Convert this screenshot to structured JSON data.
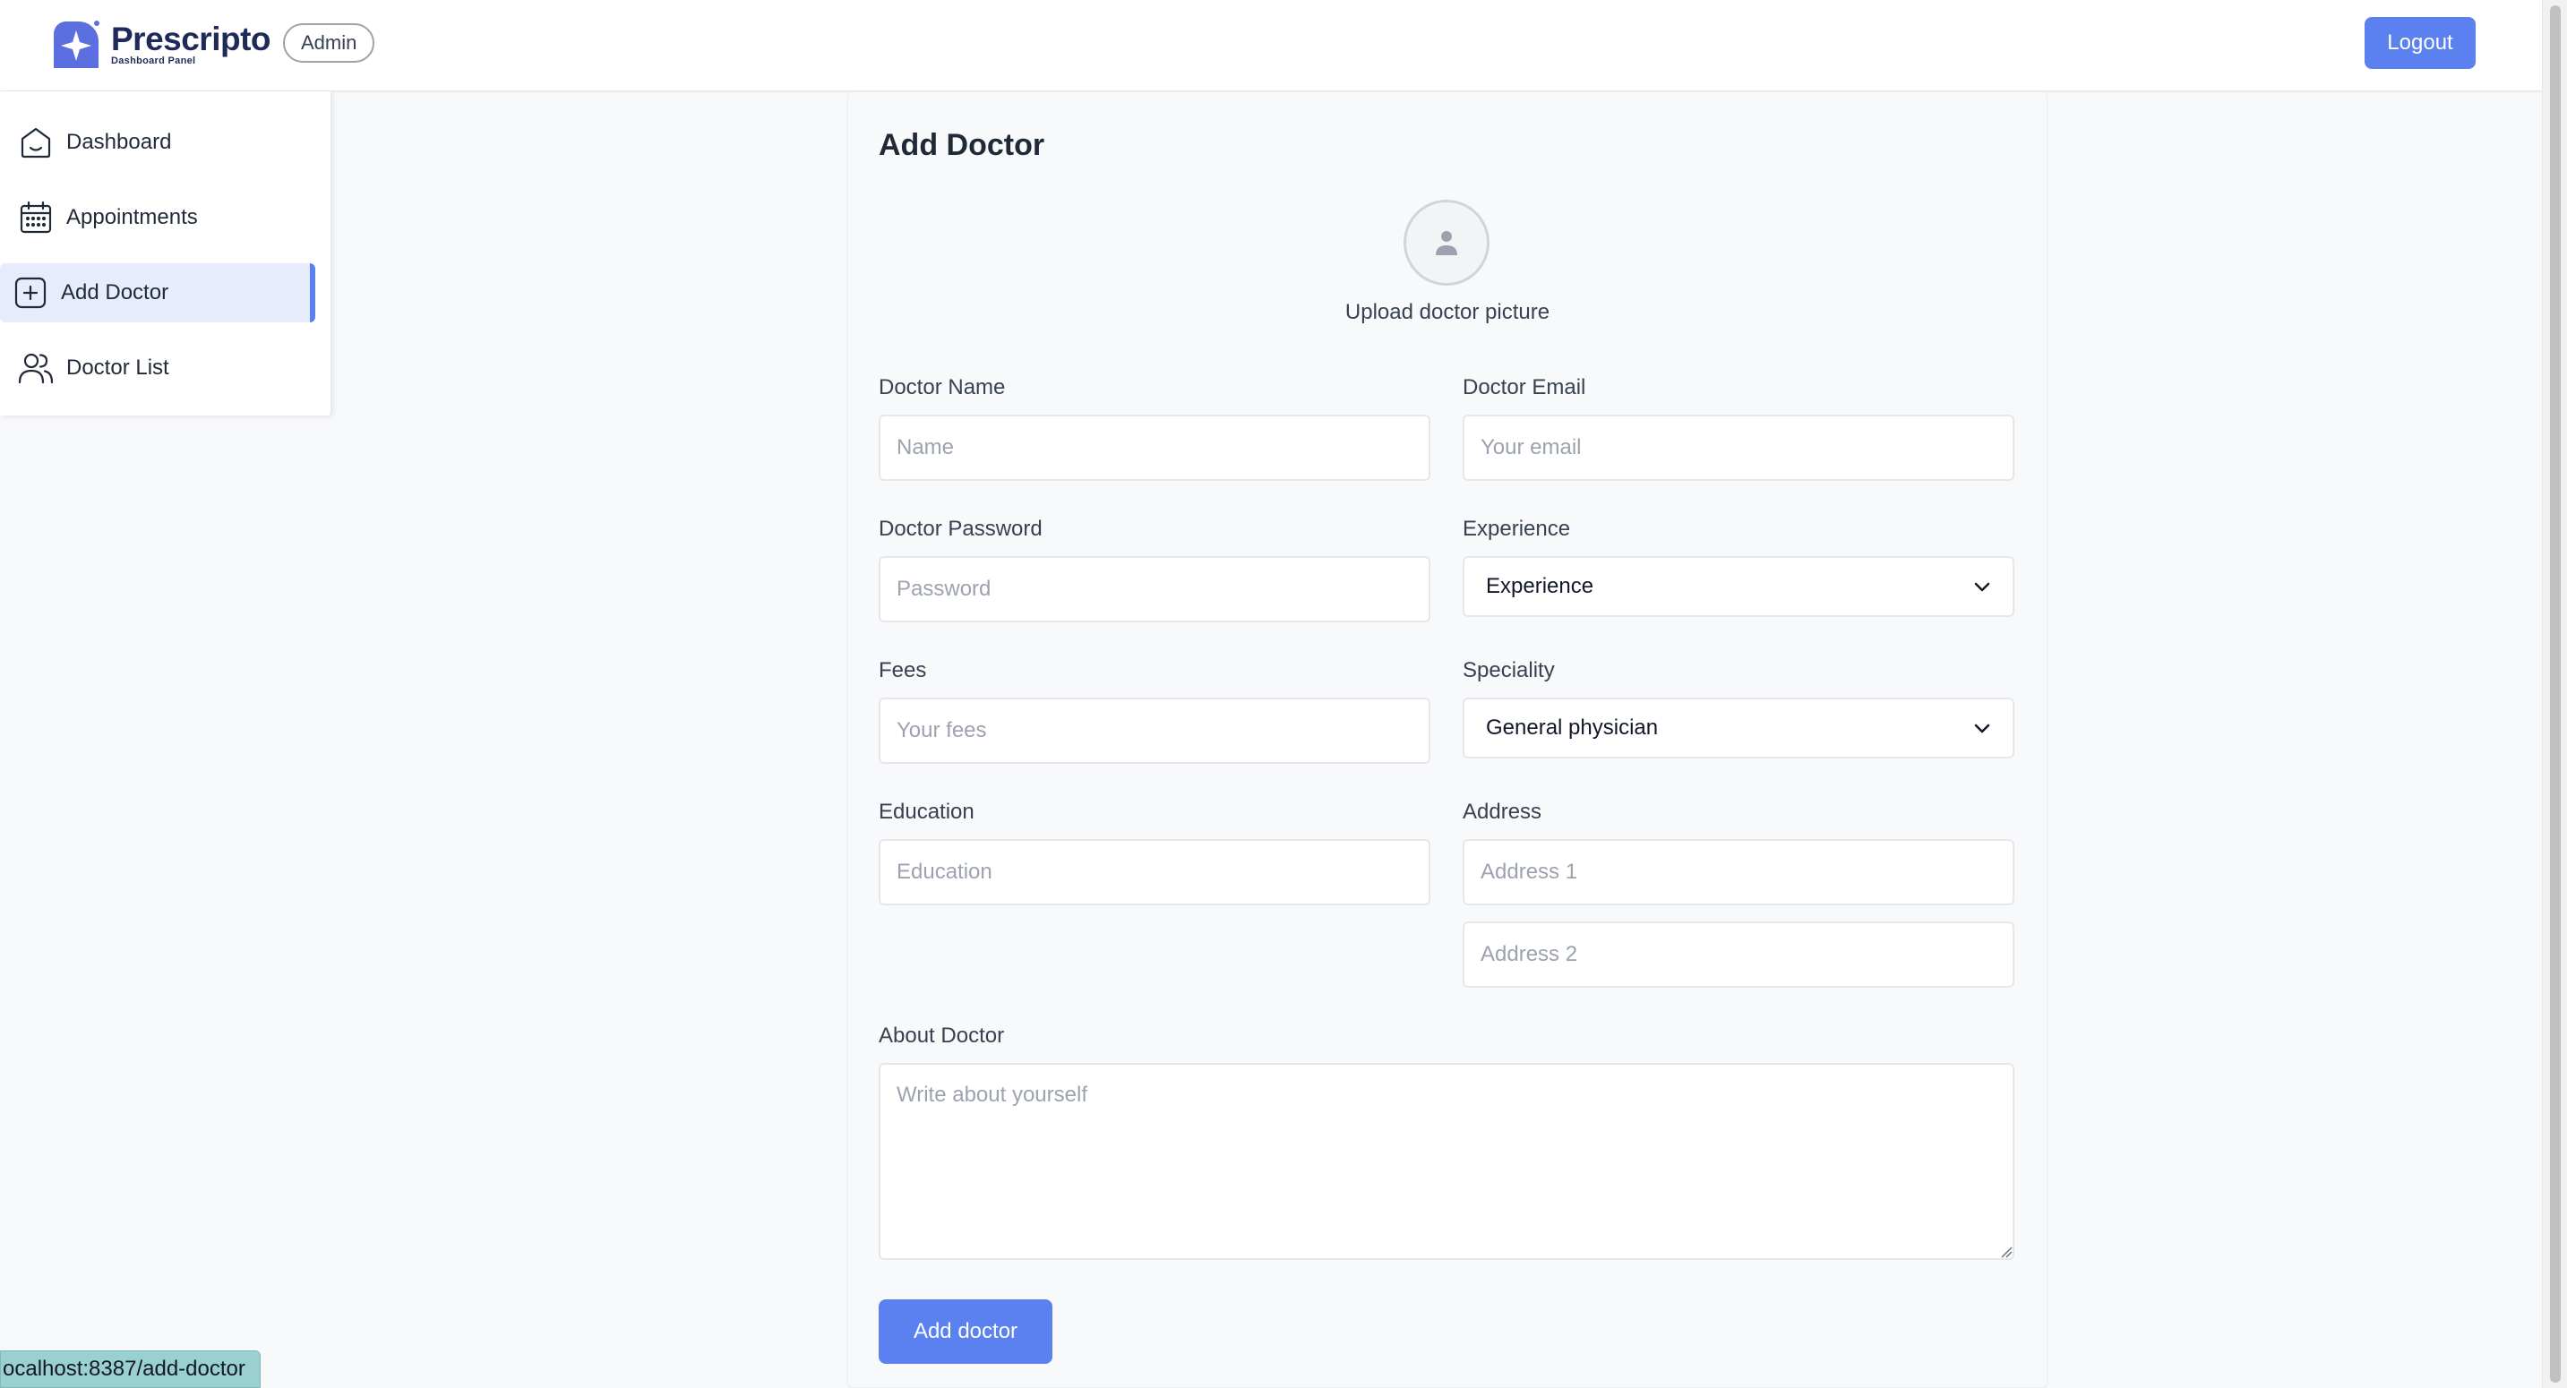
{
  "header": {
    "logo_name": "Prescripto",
    "logo_subtitle": "Dashboard Panel",
    "role_badge": "Admin",
    "logout_label": "Logout"
  },
  "sidebar": {
    "items": [
      {
        "label": "Dashboard",
        "icon": "home-icon",
        "active": false
      },
      {
        "label": "Appointments",
        "icon": "calendar-icon",
        "active": false
      },
      {
        "label": "Add Doctor",
        "icon": "add-square-icon",
        "active": true
      },
      {
        "label": "Doctor List",
        "icon": "people-icon",
        "active": false
      }
    ]
  },
  "form": {
    "title": "Add Doctor",
    "upload_label": "Upload doctor picture",
    "doctor_name": {
      "label": "Doctor Name",
      "placeholder": "Name",
      "value": ""
    },
    "doctor_email": {
      "label": "Doctor Email",
      "placeholder": "Your email",
      "value": ""
    },
    "doctor_password": {
      "label": "Doctor Password",
      "placeholder": "Password",
      "value": ""
    },
    "experience": {
      "label": "Experience",
      "selected": "Experience"
    },
    "fees": {
      "label": "Fees",
      "placeholder": "Your fees",
      "value": ""
    },
    "speciality": {
      "label": "Speciality",
      "selected": "General physician"
    },
    "education": {
      "label": "Education",
      "placeholder": "Education",
      "value": ""
    },
    "address": {
      "label": "Address",
      "placeholder_1": "Address 1",
      "placeholder_2": "Address 2"
    },
    "about": {
      "label": "About Doctor",
      "placeholder": "Write about yourself"
    },
    "submit_label": "Add doctor"
  },
  "status_bar": {
    "url": "ocalhost:8387/add-doctor"
  },
  "colors": {
    "accent": "#5b80f0",
    "active_bg": "#e6ecfc",
    "brand_navy": "#1e2a5a"
  }
}
